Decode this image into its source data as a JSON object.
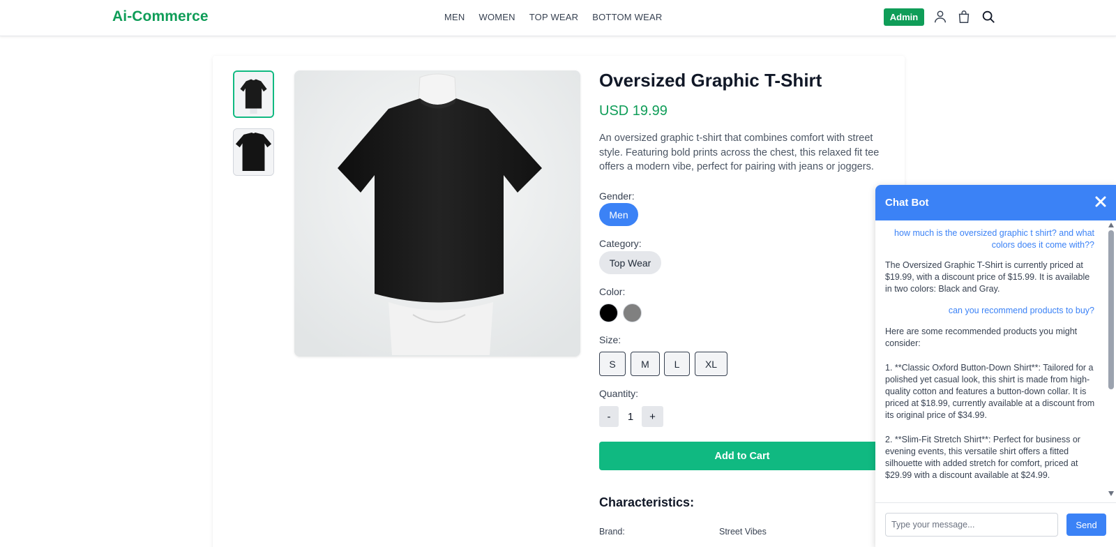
{
  "header": {
    "logo": "Ai-Commerce",
    "nav": [
      "MEN",
      "WOMEN",
      "TOP WEAR",
      "BOTTOM WEAR"
    ],
    "admin_label": "Admin",
    "icons": [
      "user-icon",
      "shopping-bag-icon",
      "search-icon"
    ]
  },
  "product": {
    "title": "Oversized Graphic T-Shirt",
    "price": "USD 19.99",
    "description": "An oversized graphic t-shirt that combines comfort with street style. Featuring bold prints across the chest, this relaxed fit tee offers a modern vibe, perfect for pairing with jeans or joggers.",
    "gender_label": "Gender:",
    "gender_value": "Men",
    "category_label": "Category:",
    "category_value": "Top Wear",
    "color_label": "Color:",
    "colors": [
      "#000000",
      "#808080"
    ],
    "size_label": "Size:",
    "sizes": [
      "S",
      "M",
      "L",
      "XL"
    ],
    "quantity_label": "Quantity:",
    "qty_minus": "-",
    "qty_value": "1",
    "qty_plus": "+",
    "add_to_cart": "Add to Cart",
    "characteristics_title": "Characteristics:",
    "brand_label": "Brand:",
    "brand_value": "Street Vibes"
  },
  "chat": {
    "title": "Chat Bot",
    "messages": [
      {
        "role": "user",
        "text": "how much is the oversized graphic t shirt? and what colors does it come with??"
      },
      {
        "role": "bot",
        "text": "The Oversized Graphic T-Shirt is currently priced at $19.99, with a discount price of $15.99. It is available in two colors: Black and Gray."
      },
      {
        "role": "user",
        "text": "can you recommend products to buy?"
      },
      {
        "role": "bot",
        "text": "Here are some recommended products you might consider:\n\n1. **Classic Oxford Button-Down Shirt**: Tailored for a polished yet casual look, this shirt is made from high-quality cotton and features a button-down collar. It is priced at $18.99, currently available at a discount from its original price of $34.99.\n\n2. **Slim-Fit Stretch Shirt**: Perfect for business or evening events, this versatile shirt offers a fitted silhouette with added stretch for comfort, priced at $29.99 with a discount available at $24.99."
      }
    ],
    "input_placeholder": "Type your message...",
    "send_label": "Send"
  },
  "colors": {
    "brand_green": "#0f9d58",
    "accent_green": "#10b981",
    "chat_blue": "#3b82f6"
  }
}
